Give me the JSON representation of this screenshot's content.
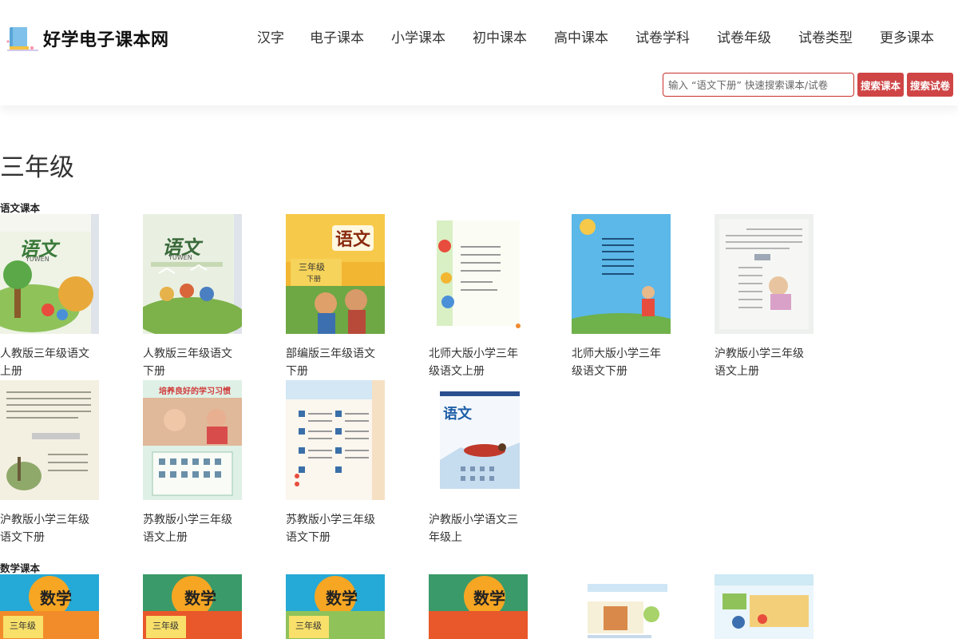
{
  "site": {
    "name": "好学电子课本网"
  },
  "nav": [
    {
      "label": "汉字"
    },
    {
      "label": "电子课本"
    },
    {
      "label": "小学课本"
    },
    {
      "label": "初中课本"
    },
    {
      "label": "高中课本"
    },
    {
      "label": "试卷学科"
    },
    {
      "label": "试卷年级"
    },
    {
      "label": "试卷类型"
    },
    {
      "label": "更多课本"
    }
  ],
  "search": {
    "placeholder": "输入 “语文下册” 快速搜索课本/试卷",
    "btn_books": "搜索课本",
    "btn_papers": "搜索试卷"
  },
  "page": {
    "title": "三年级"
  },
  "sections": [
    {
      "label": "语文课本",
      "books": [
        {
          "line1": "人教版三年级语文",
          "line2": "上册"
        },
        {
          "line1": "人教版三年级语文",
          "line2": "下册"
        },
        {
          "line1": "部编版三年级语文",
          "line2": "下册"
        },
        {
          "line1": "北师大版小学三年",
          "line2": "级语文上册"
        },
        {
          "line1": "北师大版小学三年",
          "line2": "级语文下册"
        },
        {
          "line1": "沪教版小学三年级",
          "line2": "语文上册"
        },
        {
          "line1": "沪教版小学三年级",
          "line2": "语文下册"
        },
        {
          "line1": "苏教版小学三年级",
          "line2": "语文上册"
        },
        {
          "line1": "苏教版小学三年级",
          "line2": "语文下册"
        },
        {
          "line1": "沪教版小学语文三",
          "line2": "年级上"
        }
      ]
    },
    {
      "label": "数学课本"
    }
  ],
  "covers": {
    "cover_text_yuwen": "语文",
    "cover_text_yuwen_pinyin": "YUWEN",
    "cover_text_grade": "三年级",
    "cover_text_xiace": "下册",
    "cover_text_math": "数学",
    "cover_text_habit": "培养良好的学习习惯"
  },
  "colors": {
    "accent": "#cf4546",
    "border_red": "#c9302c"
  }
}
